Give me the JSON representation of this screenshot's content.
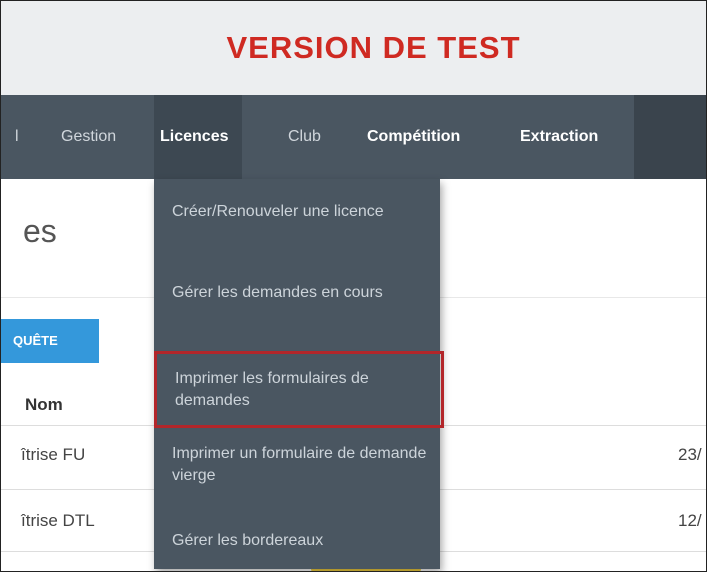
{
  "banner": {
    "title": "VERSION DE TEST"
  },
  "nav": {
    "items": [
      "l",
      "Gestion",
      "Licences",
      "Club",
      "Compétition",
      "Extraction"
    ]
  },
  "licences_menu": [
    "Créer/Renouveler une licence",
    "Gérer les demandes en cours",
    "Imprimer les formulaires de demandes",
    "Imprimer un formulaire de demande vierge",
    "Gérer les bordereaux"
  ],
  "page": {
    "title": "es",
    "enquete_button": "QUÊTE",
    "column_header": "Nom",
    "rows": [
      {
        "name": "îtrise FU",
        "date": "23/"
      },
      {
        "name": "îtrise DTL",
        "date": "12/"
      }
    ]
  },
  "colors": {
    "banner_title": "#cf2a22",
    "navbar": "#4a5661",
    "highlight_border": "#b3262a",
    "enquete_button": "#3498db"
  }
}
